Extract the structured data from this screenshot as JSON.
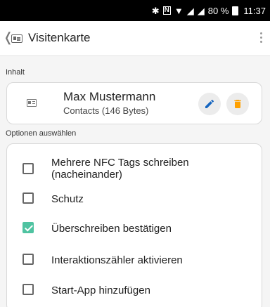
{
  "status_bar": {
    "bluetooth": "✱",
    "nfc": "N",
    "battery_text": "80 %",
    "time": "11:37"
  },
  "app_bar": {
    "back_glyph": "❬",
    "title": "Visitenkarte"
  },
  "content": {
    "section_label": "Inhalt",
    "name": "Max Mustermann",
    "subtitle": "Contacts (146 Bytes)",
    "edit_color": "#1565c0",
    "delete_color": "#ffa000"
  },
  "options": {
    "section_label": "Optionen auswählen",
    "items": [
      {
        "label": "Mehrere NFC Tags schreiben\n(nacheinander)",
        "checked": false
      },
      {
        "label": "Schutz",
        "checked": false
      },
      {
        "label": "Überschreiben bestätigen",
        "checked": true
      },
      {
        "label": "Interaktionszähler aktivieren",
        "checked": false
      },
      {
        "label": "Start-App hinzufügen",
        "checked": false
      }
    ]
  }
}
